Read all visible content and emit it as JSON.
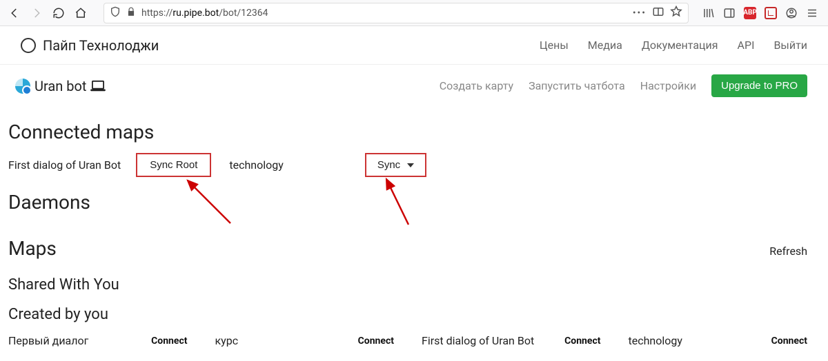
{
  "browser": {
    "url_prefix": "https://",
    "url_domain": "ru.pipe.bot",
    "url_path": "/bot/12364",
    "abp_label": "ABP"
  },
  "site_header": {
    "brand": "Пайп Технолоджи",
    "nav": {
      "prices": "Цены",
      "media": "Медиа",
      "docs": "Документация",
      "api": "API",
      "logout": "Выйти"
    }
  },
  "bot_bar": {
    "title": "Uran bot",
    "nav": {
      "create_map": "Создать карту",
      "run_bot": "Запустить чатбота",
      "settings": "Настройки"
    },
    "upgrade": "Upgrade to PRO"
  },
  "sections": {
    "connected_maps": "Connected maps",
    "daemons": "Daemons",
    "maps": "Maps",
    "shared": "Shared With You",
    "created": "Created by you",
    "refresh": "Refresh"
  },
  "connected": {
    "item1_label": "First dialog of Uran Bot",
    "item1_button": "Sync Root",
    "item2_label": "technology",
    "item2_button": "Sync"
  },
  "created_items": [
    {
      "name": "Первый диалог",
      "action": "Connect"
    },
    {
      "name": "курс",
      "action": "Connect"
    },
    {
      "name": "First dialog of Uran Bot",
      "action": "Connect"
    },
    {
      "name": "technology",
      "action": "Connect"
    }
  ]
}
